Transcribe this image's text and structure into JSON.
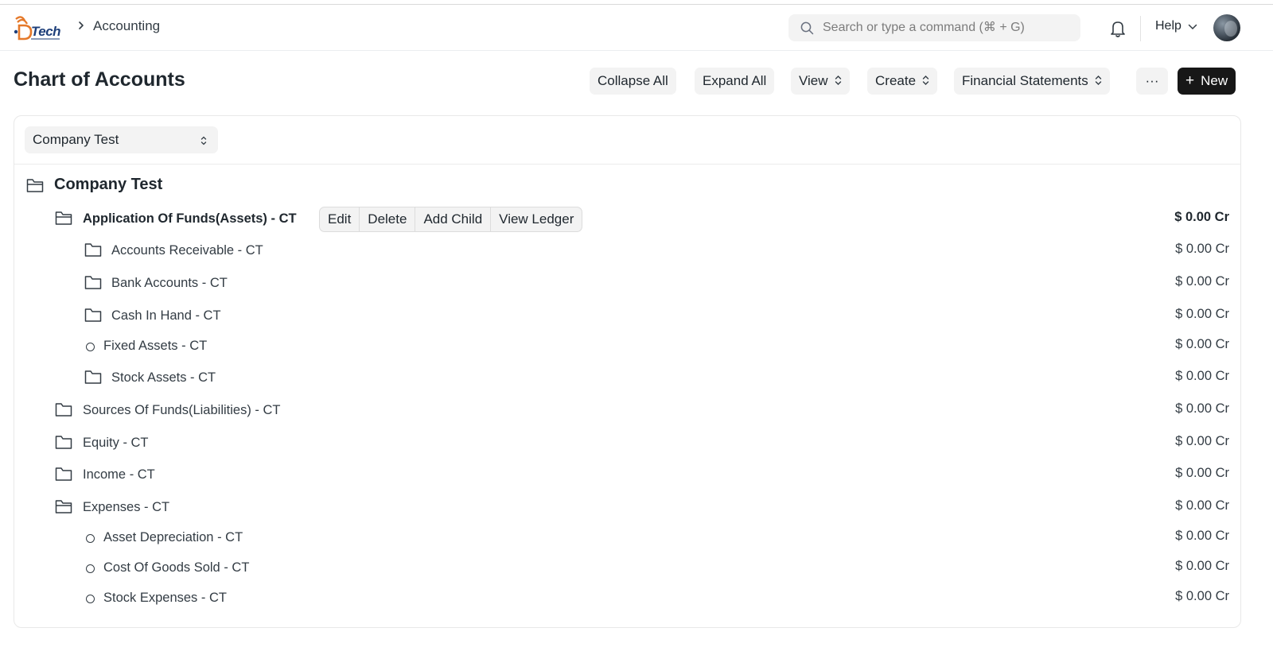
{
  "navbar": {
    "logo_text": "Tech",
    "breadcrumb": "Accounting",
    "search_placeholder": "Search or type a command (⌘ + G)",
    "help_label": "Help"
  },
  "page": {
    "title": "Chart of Accounts",
    "buttons": {
      "collapse_all": "Collapse All",
      "expand_all": "Expand All",
      "view": "View",
      "create": "Create",
      "financial_statements": "Financial Statements",
      "more": "···",
      "new": "New"
    }
  },
  "filter": {
    "company": "Company Test"
  },
  "tree": {
    "root": "Company Test",
    "row_actions": [
      "Edit",
      "Delete",
      "Add Child",
      "View Ledger"
    ],
    "rows": [
      {
        "label": "Application Of Funds(Assets) - CT",
        "balance": "$ 0.00 Cr",
        "type": "folder-open",
        "level": 1,
        "selected": true
      },
      {
        "label": "Accounts Receivable - CT",
        "balance": "$ 0.00 Cr",
        "type": "folder",
        "level": 2
      },
      {
        "label": "Bank Accounts - CT",
        "balance": "$ 0.00 Cr",
        "type": "folder",
        "level": 2
      },
      {
        "label": "Cash In Hand - CT",
        "balance": "$ 0.00 Cr",
        "type": "folder",
        "level": 2
      },
      {
        "label": "Fixed Assets - CT",
        "balance": "$ 0.00 Cr",
        "type": "leaf",
        "level": 2
      },
      {
        "label": "Stock Assets - CT",
        "balance": "$ 0.00 Cr",
        "type": "folder",
        "level": 2
      },
      {
        "label": "Sources Of Funds(Liabilities) - CT",
        "balance": "$ 0.00 Cr",
        "type": "folder",
        "level": 1
      },
      {
        "label": "Equity - CT",
        "balance": "$ 0.00 Cr",
        "type": "folder",
        "level": 1
      },
      {
        "label": "Income - CT",
        "balance": "$ 0.00 Cr",
        "type": "folder",
        "level": 1
      },
      {
        "label": "Expenses - CT",
        "balance": "$ 0.00 Cr",
        "type": "folder-open",
        "level": 1
      },
      {
        "label": "Asset Depreciation - CT",
        "balance": "$ 0.00 Cr",
        "type": "leaf",
        "level": 2
      },
      {
        "label": "Cost Of Goods Sold - CT",
        "balance": "$ 0.00 Cr",
        "type": "leaf",
        "level": 2
      },
      {
        "label": "Stock Expenses - CT",
        "balance": "$ 0.00 Cr",
        "type": "leaf",
        "level": 2
      }
    ]
  },
  "colors": {
    "primary_button": "#171717",
    "button_bg": "#f3f3f3",
    "logo_orange": "#e5792a",
    "logo_blue": "#1e3f7a"
  },
  "icons": [
    "search-icon",
    "bell-icon",
    "chevron-right-icon",
    "chevron-down-icon",
    "updown-icon",
    "folder-icon",
    "folder-open-icon",
    "leaf-circle-icon",
    "plus-icon",
    "avatar"
  ]
}
